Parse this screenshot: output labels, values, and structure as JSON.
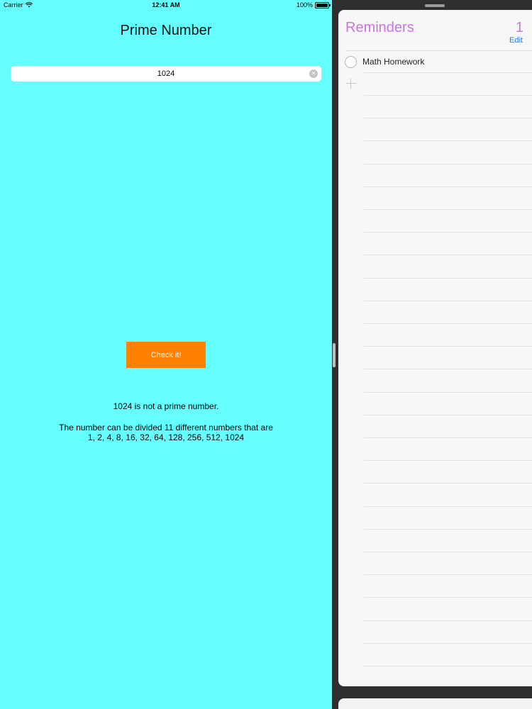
{
  "status_bar": {
    "carrier": "Carrier",
    "wifi_icon": "wifi-icon",
    "time": "12:41 AM",
    "battery_text": "100%",
    "battery_level": 1.0
  },
  "prime_app": {
    "title": "Prime Number",
    "input_value": "1024",
    "button_label": "Check it!",
    "result_line": "1024 is not a prime number.",
    "divisors_line_1": "The number can be divided 11 different numbers that are",
    "divisors_line_2": "1, 2, 4, 8, 16, 32, 64, 128, 256, 512, 1024",
    "background_color": "#66ffff",
    "button_color": "#ff7f00"
  },
  "reminders": {
    "title": "Reminders",
    "count": "1",
    "edit_label": "Edit",
    "items": [
      {
        "text": "Math Homework",
        "completed": false
      }
    ],
    "accent_color": "#cc73e1"
  }
}
